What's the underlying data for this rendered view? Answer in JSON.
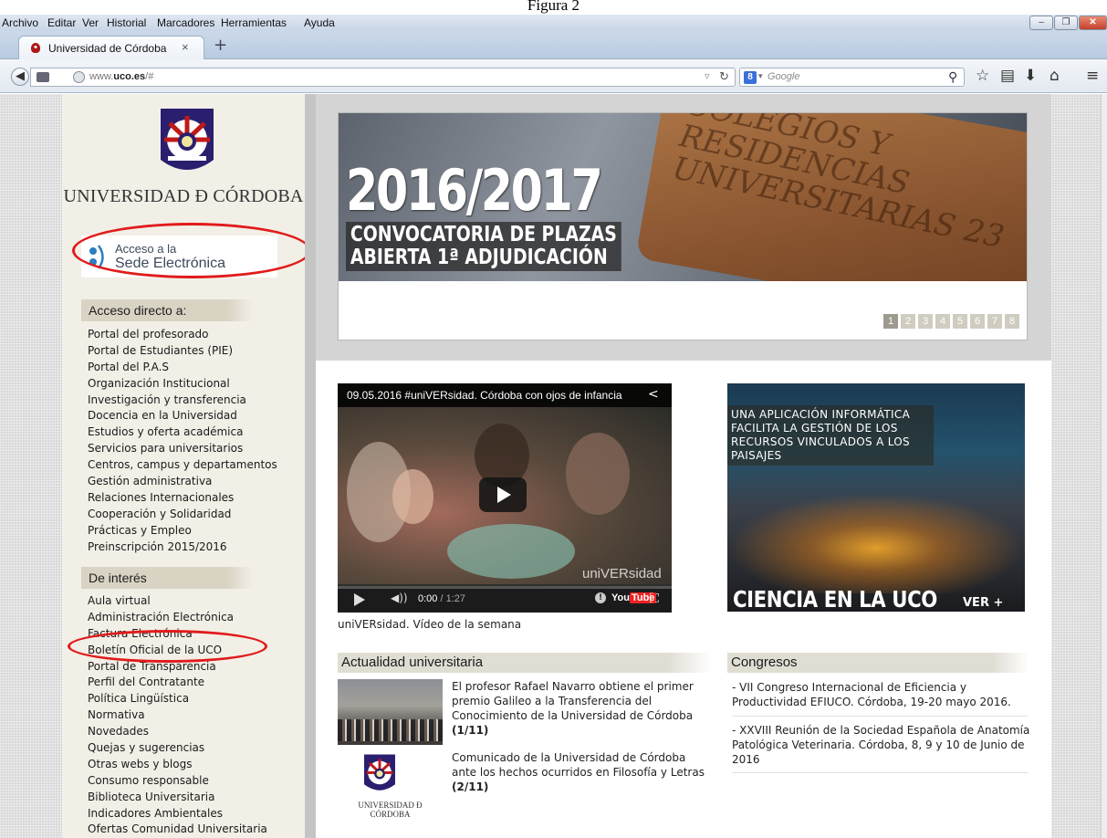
{
  "caption": "Figura 2",
  "menubar": {
    "items": [
      {
        "label": "Archivo",
        "accel": "A"
      },
      {
        "label": "Editar",
        "accel": "E"
      },
      {
        "label": "Ver",
        "accel": "V"
      },
      {
        "label": "Historial",
        "accel": "s"
      },
      {
        "label": "Marcadores",
        "accel": "M"
      },
      {
        "label": "Herramientas",
        "accel": "t"
      },
      {
        "label": "Ayuda",
        "accel": "u"
      }
    ]
  },
  "tab": {
    "title": "Universidad de Córdoba",
    "close": "×",
    "new_tab": "+"
  },
  "urlbar": {
    "prefix": "www.",
    "domain": "uco.es",
    "suffix": "/#"
  },
  "searchbar": {
    "engine_icon": "google-icon",
    "placeholder": "Google"
  },
  "sidebar": {
    "university_name": "UNIVERSIDAD Ð CÓRDOBA",
    "sede": {
      "line1": "Acceso a la",
      "line2": "Sede Electrónica"
    },
    "acceso_heading": "Acceso directo a:",
    "acceso_items": [
      "Portal del profesorado",
      "Portal de Estudiantes (PIE)",
      "Portal del P.A.S",
      "Organización Institucional",
      "Investigación y transferencia",
      "Docencia en la Universidad",
      "Estudios y oferta académica",
      "Servicios para universitarios",
      "Centros, campus y departamentos",
      "Gestión administrativa",
      "Relaciones Internacionales",
      "Cooperación y Solidaridad",
      "Prácticas y Empleo",
      "Preinscripción 2015/2016"
    ],
    "interes_heading": "De interés",
    "interes_items": [
      "Aula virtual",
      "Administración Electrónica",
      "Factura Electrónica",
      "Boletín Oficial de la UCO",
      "Portal de Transparencia",
      "Perfil del Contratante",
      "Política Lingüística",
      "Normativa",
      "Novedades",
      "Quejas y sugerencias",
      "Otras webs y blogs",
      "Consumo responsable",
      "Biblioteca Universitaria",
      "Indicadores Ambientales",
      "Ofertas Comunidad Universitaria"
    ]
  },
  "banner": {
    "headline": "2016/2017",
    "sub_line1": "CONVOCATORIA DE PLAZAS",
    "sub_line2": "ABIERTA 1ª ADJUDICACIÓN",
    "tag_text": "COLEGIOS Y RESIDENCIAS UNIVERSITARIAS",
    "tag_number": "23",
    "pages": [
      "1",
      "2",
      "3",
      "4",
      "5",
      "6",
      "7",
      "8"
    ],
    "active_page": "1"
  },
  "video": {
    "title": "09.05.2016 #uniVERsidad. Córdoba con ojos de infancia",
    "watermark": "uniVERsidad",
    "time_current": "0:00",
    "time_total": "/ 1:27",
    "youtube_label": "You",
    "youtube_tube": "Tube",
    "caption": "uniVERsidad. Vídeo de la semana"
  },
  "promo": {
    "text": "UNA APLICACIÓN INFORMÁTICA FACILITA LA GESTIÓN DE LOS RECURSOS VINCULADOS A LOS PAISAJES",
    "title": "CIENCIA EN LA UCO",
    "more": "VER +"
  },
  "news": {
    "heading": "Actualidad universitaria",
    "logo_name": "UNIVERSIDAD Ð CÓRDOBA",
    "items": [
      {
        "text": "El profesor Rafael Navarro obtiene el primer premio Galileo a la Transferencia del Conocimiento de la Universidad de Córdoba ",
        "index": "(1/11)"
      },
      {
        "text": "Comunicado de la Universidad de Córdoba ante los hechos ocurridos en Filosofía y Letras ",
        "index": "(2/11)"
      }
    ]
  },
  "congresos": {
    "heading": "Congresos",
    "items": [
      "- VII Congreso Internacional de Eficiencia y Productividad EFIUCO. Córdoba, 19-20 mayo 2016.",
      "- XXVIII Reunión de la Sociedad Española de Anatomía Patológica Veterinaria. Córdoba, 8, 9 y 10 de Junio de 2016"
    ]
  },
  "colors": {
    "highlight_oval": "#e11b1b",
    "sidebar_bg": "#f2efe7",
    "heading_bg": "#d9d3c4"
  }
}
